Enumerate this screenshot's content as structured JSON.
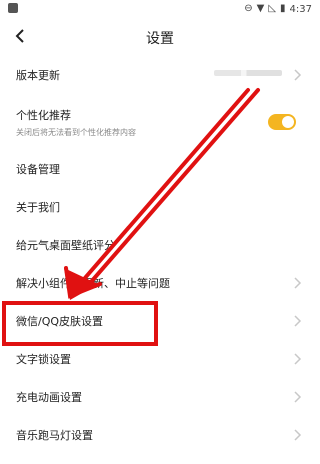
{
  "status": {
    "time": "4:37"
  },
  "header": {
    "title": "设置"
  },
  "settings": {
    "items": [
      {
        "label": "版本更新"
      },
      {
        "label": "个性化推荐",
        "description": "关闭后将无法看到个性化推荐内容"
      },
      {
        "label": "设备管理"
      },
      {
        "label": "关于我们"
      },
      {
        "label": "给元气桌面壁纸评分"
      },
      {
        "label": "解决小组件不更新、中止等问题"
      },
      {
        "label": "微信/QQ皮肤设置"
      },
      {
        "label": "文字锁设置"
      },
      {
        "label": "充电动画设置"
      },
      {
        "label": "音乐跑马灯设置"
      }
    ]
  },
  "colors": {
    "toggle_on": "#f4b521",
    "annotation_red": "#e01111"
  }
}
